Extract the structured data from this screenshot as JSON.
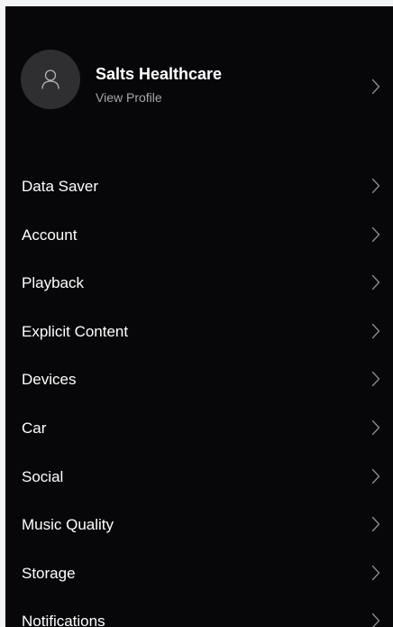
{
  "profile": {
    "name": "Salts Healthcare",
    "link": "View Profile",
    "avatar_icon": "user-icon"
  },
  "menu": {
    "items": [
      {
        "label": "Data Saver"
      },
      {
        "label": "Account"
      },
      {
        "label": "Playback"
      },
      {
        "label": "Explicit Content"
      },
      {
        "label": "Devices"
      },
      {
        "label": "Car"
      },
      {
        "label": "Social"
      },
      {
        "label": "Music Quality"
      },
      {
        "label": "Storage"
      },
      {
        "label": "Notifications"
      }
    ]
  },
  "colors": {
    "background": "#07070a",
    "avatar": "#2f2f31",
    "text": "#ffffff",
    "secondary_text": "#a7a7a9",
    "chevron": "#8e8e92"
  }
}
